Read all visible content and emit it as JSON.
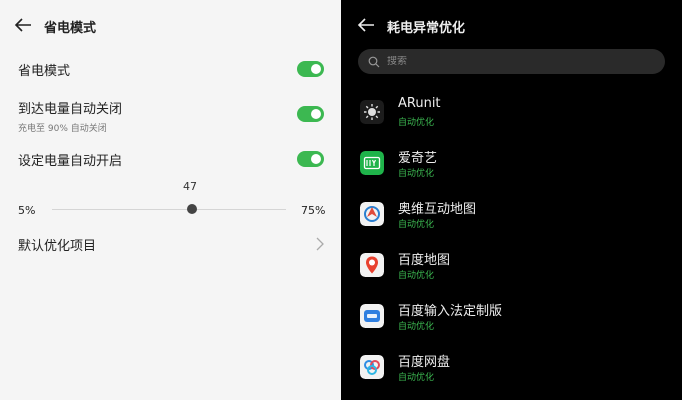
{
  "left": {
    "title": "省电模式",
    "settings": [
      {
        "label": "省电模式",
        "sub": "",
        "toggle_on": true
      },
      {
        "label": "到达电量自动关闭",
        "sub": "充电至 90% 自动关闭",
        "toggle_on": true
      },
      {
        "label": "设定电量自动开启",
        "sub": "",
        "toggle_on": true
      }
    ],
    "slider": {
      "value": "47",
      "min_label": "5%",
      "max_label": "75%",
      "min": 5,
      "max": 75,
      "current": 47
    },
    "default_items_label": "默认优化项目"
  },
  "right": {
    "title": "耗电异常优化",
    "search_placeholder": "搜索",
    "apps": [
      {
        "name": "ARunit",
        "status": "自动优化",
        "icon": "arunit-icon"
      },
      {
        "name": "爱奇艺",
        "status": "自动优化",
        "icon": "iqiyi-icon"
      },
      {
        "name": "奥维互动地图",
        "status": "自动优化",
        "icon": "ovital-map-icon"
      },
      {
        "name": "百度地图",
        "status": "自动优化",
        "icon": "baidu-map-icon"
      },
      {
        "name": "百度输入法定制版",
        "status": "自动优化",
        "icon": "baidu-input-icon"
      },
      {
        "name": "百度网盘",
        "status": "自动优化",
        "icon": "baidu-netdisk-icon"
      }
    ]
  },
  "colors": {
    "accent_green": "#3cb851",
    "dark_bg": "#000000",
    "light_bg": "#f5f5f5"
  }
}
